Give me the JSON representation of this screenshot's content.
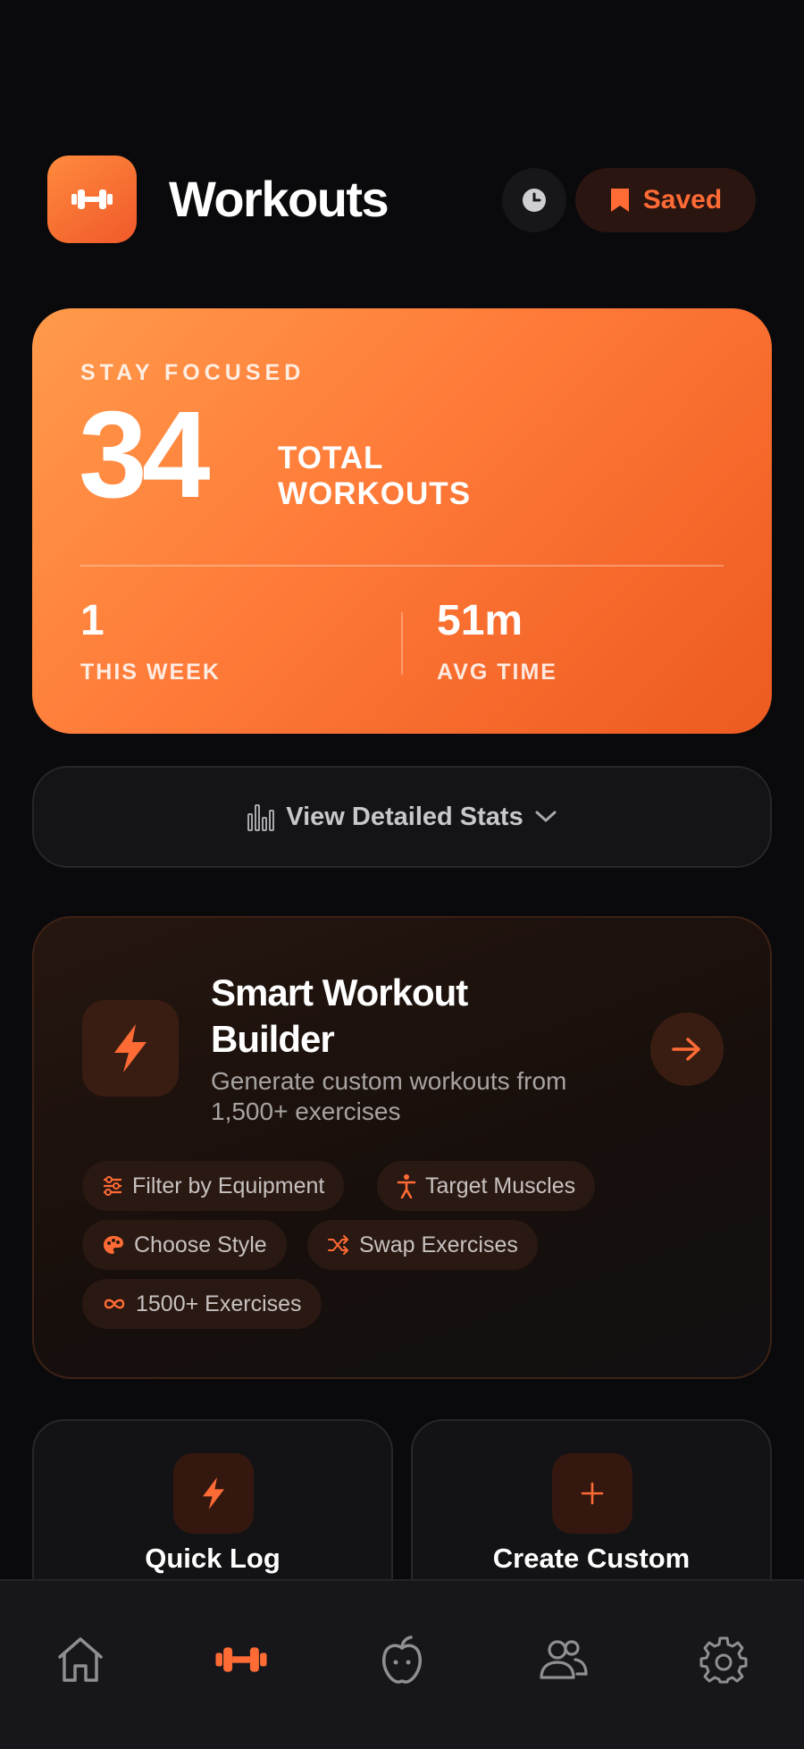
{
  "header": {
    "logo_icon": "dumbbell-icon",
    "title": "Workouts",
    "history_icon": "clock-icon",
    "saved_icon": "bookmark-icon",
    "saved_label": "Saved"
  },
  "summary": {
    "eyebrow": "STAY FOCUSED",
    "total_value": "34",
    "total_label": "TOTAL WORKOUTS",
    "this_week_value": "1",
    "this_week_label": "THIS WEEK",
    "avg_time_value": "51m",
    "avg_time_label": "AVG TIME"
  },
  "stats_button": {
    "icon": "bar-chart-icon",
    "label": "View Detailed Stats",
    "chevron": "chevron-down-icon"
  },
  "builder": {
    "icon": "lightning-icon",
    "title": "Smart Workout Builder",
    "description": "Generate custom workouts from 1,500+ exercises",
    "arrow_icon": "arrow-right-icon",
    "chips": [
      {
        "icon": "sliders-icon",
        "label": "Filter by Equipment"
      },
      {
        "icon": "person-icon",
        "label": "Target Muscles"
      },
      {
        "icon": "palette-icon",
        "label": "Choose Style"
      },
      {
        "icon": "shuffle-icon",
        "label": "Swap Exercises"
      },
      {
        "icon": "infinity-icon",
        "label": "1500+ Exercises"
      }
    ]
  },
  "actions": [
    {
      "icon": "lightning-icon",
      "label": "Quick Log"
    },
    {
      "icon": "plus-icon",
      "label": "Create Custom"
    }
  ],
  "tabbar": {
    "tabs": [
      {
        "icon": "home-icon",
        "active": false
      },
      {
        "icon": "dumbbell-icon",
        "active": true
      },
      {
        "icon": "apple-icon",
        "active": false
      },
      {
        "icon": "users-icon",
        "active": false
      },
      {
        "icon": "gear-icon",
        "active": false
      }
    ]
  },
  "colors": {
    "background": "#0a0a0c",
    "accent": "#ff6b35",
    "card": "#141417",
    "muted_text": "#a7a3a2"
  }
}
